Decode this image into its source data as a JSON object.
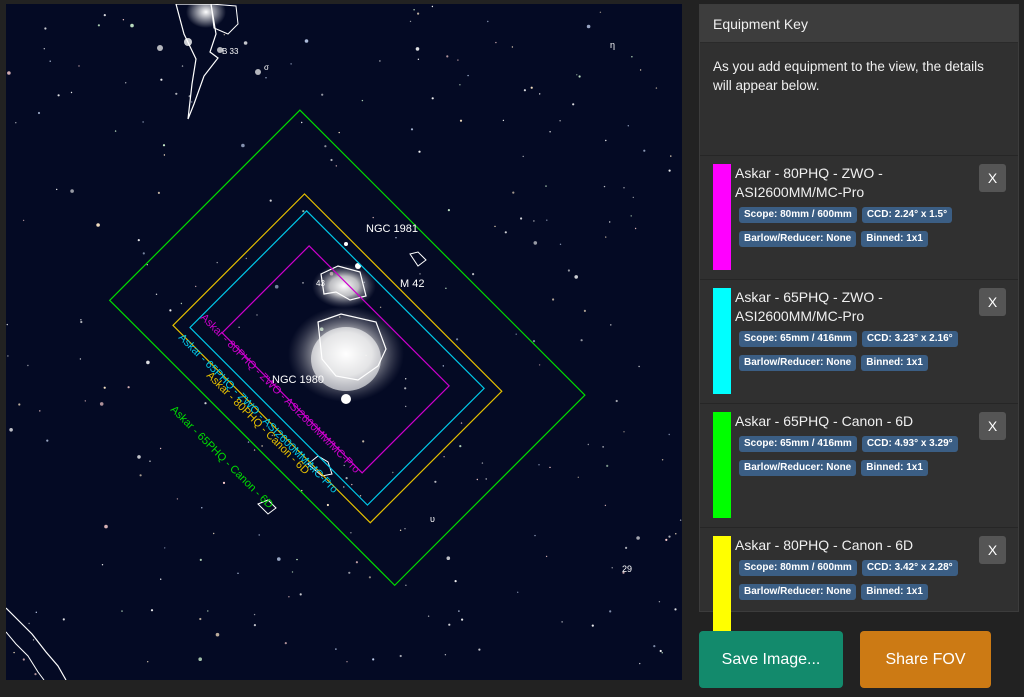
{
  "panel": {
    "title": "Equipment Key",
    "intro": "As you add equipment to the view, the details will appear below.",
    "remove_label": "X"
  },
  "equipment": [
    {
      "name": "Askar - 80PHQ - ZWO - ASI2600MM/MC-Pro",
      "color": "#ff00ff",
      "scope": "Scope: 80mm / 600mm",
      "ccd": "CCD: 2.24° x 1.5°",
      "barlow": "Barlow/Reducer: None",
      "binned": "Binned: 1x1"
    },
    {
      "name": "Askar - 65PHQ - ZWO - ASI2600MM/MC-Pro",
      "color": "#00ffff",
      "scope": "Scope: 65mm / 416mm",
      "ccd": "CCD: 3.23° x 2.16°",
      "barlow": "Barlow/Reducer: None",
      "binned": "Binned: 1x1"
    },
    {
      "name": "Askar - 65PHQ - Canon - 6D",
      "color": "#00ff00",
      "scope": "Scope: 65mm / 416mm",
      "ccd": "CCD: 4.93° x 3.29°",
      "barlow": "Barlow/Reducer: None",
      "binned": "Binned: 1x1"
    },
    {
      "name": "Askar - 80PHQ - Canon - 6D",
      "color": "#ffff00",
      "scope": "Scope: 80mm / 600mm",
      "ccd": "CCD: 3.42° x 2.28°",
      "barlow": "Barlow/Reducer: None",
      "binned": "Binned: 1x1"
    }
  ],
  "sky": {
    "labels": {
      "ngc1981": "NGC 1981",
      "m42": "M 42",
      "ngc1980": "NGC 1980",
      "num29": "29",
      "upsilon": "υ",
      "eta": "η",
      "b33": "B 33",
      "sigma": "σ",
      "num43": "43"
    },
    "fov_labels": {
      "magenta": "Askar - 80PHQ - ZWO - ASI2600MM/MC-Pro",
      "cyan": "Askar - 65PHQ - ZWO - ASI2600MM/MC-Pro",
      "yellow": "Askar - 80PHQ - Canon - 6D",
      "green": "Askar - 65PHQ - Canon - 6D"
    }
  },
  "actions": {
    "save": "Save Image...",
    "share": "Share FOV"
  }
}
